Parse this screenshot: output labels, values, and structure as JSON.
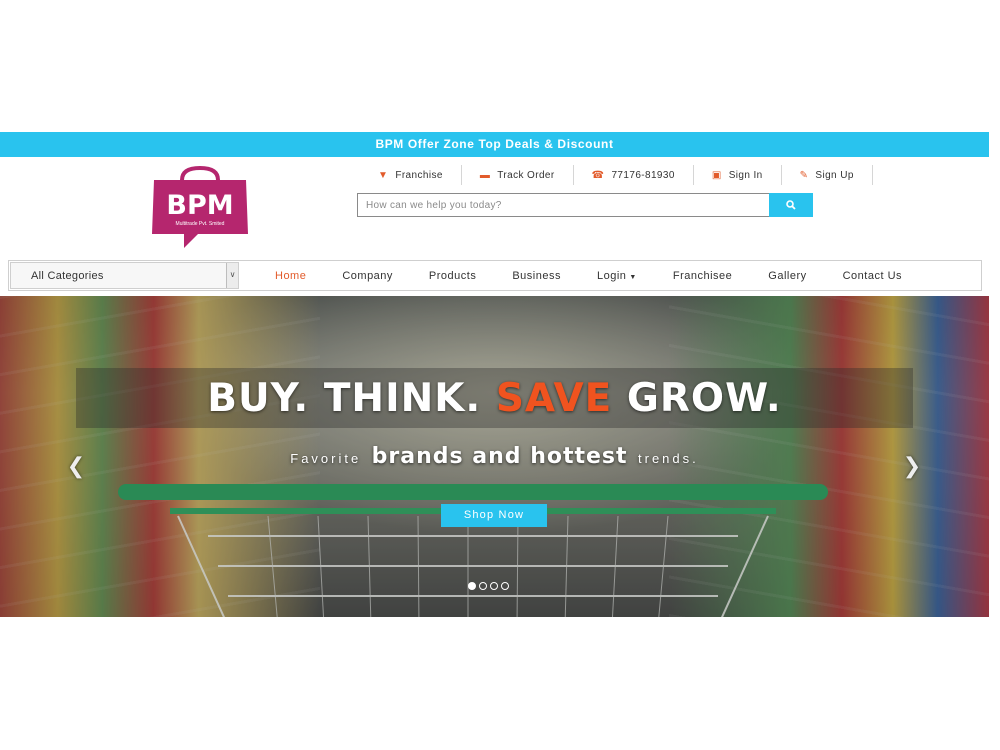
{
  "offer_bar": {
    "text": "BPM Offer Zone Top Deals & Discount"
  },
  "logo": {
    "brand": "BPM",
    "tagline": "Multitrade Pvt. Smited"
  },
  "top_links": [
    {
      "icon": "map-marker-icon",
      "label": "Franchise"
    },
    {
      "icon": "truck-icon",
      "label": "Track Order"
    },
    {
      "icon": "phone-icon",
      "label": "77176-81930"
    },
    {
      "icon": "lock-icon",
      "label": "Sign In"
    },
    {
      "icon": "edit-icon",
      "label": "Sign Up"
    }
  ],
  "search": {
    "placeholder": "How can we help you today?",
    "value": ""
  },
  "nav": {
    "category_label": "All Categories",
    "items": [
      "Home",
      "Company",
      "Products",
      "Business",
      "Login",
      "Franchisee",
      "Gallery",
      "Contact Us"
    ],
    "active": "Home"
  },
  "hero": {
    "headline_part1": "BUY. THINK.",
    "headline_accent": "SAVE",
    "headline_part2": "GROW.",
    "sub_small1": "Favorite",
    "sub_big": "brands and hottest",
    "sub_small2": "trends.",
    "button_label": "Shop Now",
    "slides_count": 4,
    "active_slide": 1
  },
  "colors": {
    "accent_blue": "#29c3ee",
    "accent_orange": "#e25b2b",
    "logo_magenta": "#b5266e"
  }
}
